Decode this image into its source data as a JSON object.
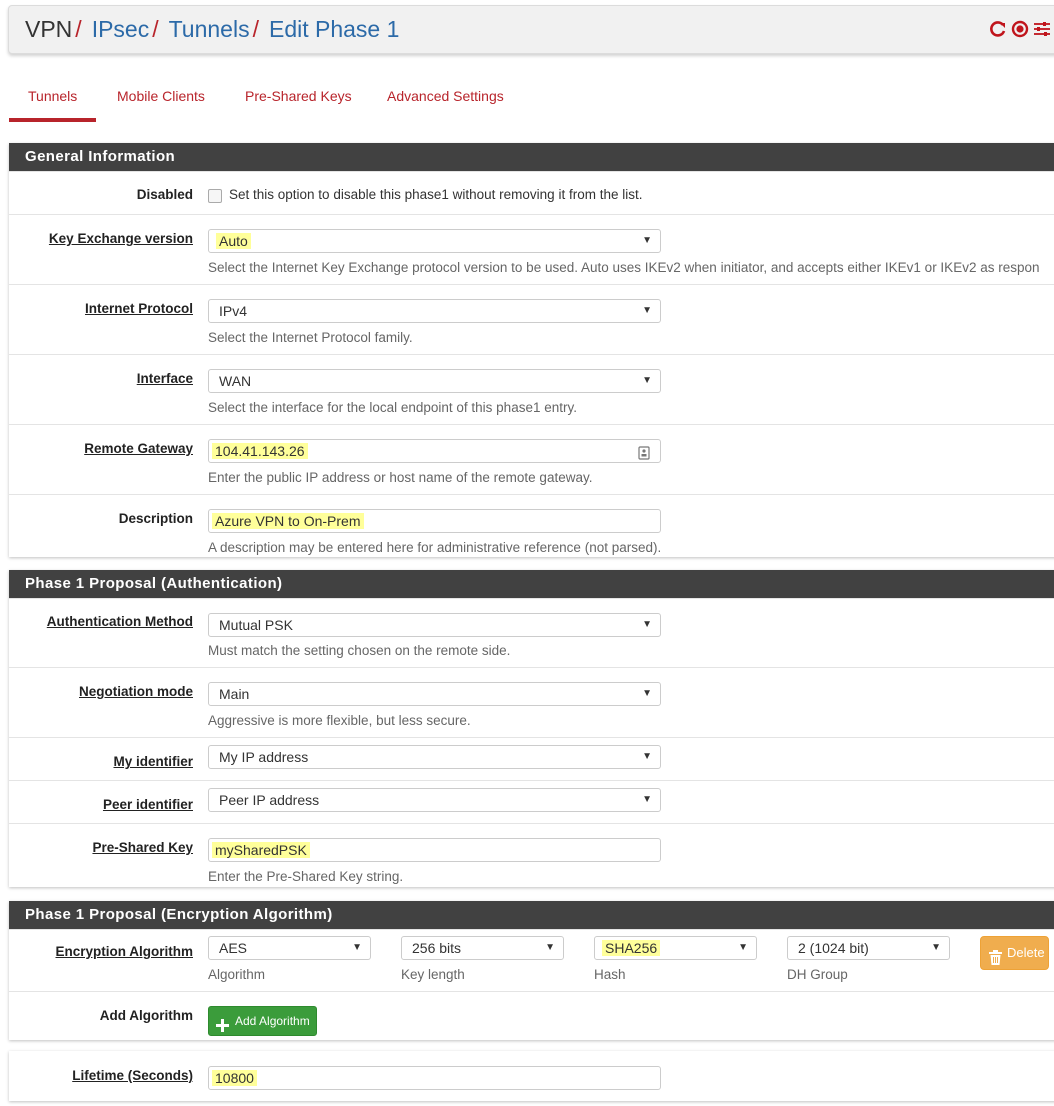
{
  "breadcrumb": {
    "items": [
      "VPN",
      "IPsec",
      "Tunnels",
      "Edit Phase 1"
    ],
    "separator": "/"
  },
  "header_icons": [
    "reload-icon",
    "stop-icon",
    "settings-sliders-icon"
  ],
  "tabs": [
    {
      "label": "Tunnels",
      "active": true
    },
    {
      "label": "Mobile Clients",
      "active": false
    },
    {
      "label": "Pre-Shared Keys",
      "active": false
    },
    {
      "label": "Advanced Settings",
      "active": false
    }
  ],
  "general": {
    "title": "General Information",
    "disabled": {
      "label": "Disabled",
      "checkbox_text": "Set this option to disable this phase1 without removing it from the list."
    },
    "key_exchange": {
      "label": "Key Exchange version",
      "value": "Auto",
      "help": "Select the Internet Key Exchange protocol version to be used. Auto uses IKEv2 when initiator, and accepts either IKEv1 or IKEv2 as respon"
    },
    "internet_protocol": {
      "label": "Internet Protocol",
      "value": "IPv4",
      "help": "Select the Internet Protocol family."
    },
    "interface": {
      "label": "Interface",
      "value": "WAN",
      "help": "Select the interface for the local endpoint of this phase1 entry."
    },
    "remote_gateway": {
      "label": "Remote Gateway",
      "value": "104.41.143.26",
      "help": "Enter the public IP address or host name of the remote gateway."
    },
    "description": {
      "label": "Description",
      "value": "Azure VPN to On-Prem",
      "help": "A description may be entered here for administrative reference (not parsed)."
    }
  },
  "auth": {
    "title": "Phase 1 Proposal (Authentication)",
    "method": {
      "label": "Authentication Method",
      "value": "Mutual PSK",
      "help": "Must match the setting chosen on the remote side."
    },
    "negotiation": {
      "label": "Negotiation mode",
      "value": "Main",
      "help": "Aggressive is more flexible, but less secure."
    },
    "my_identifier": {
      "label": "My identifier",
      "value": "My IP address"
    },
    "peer_identifier": {
      "label": "Peer identifier",
      "value": "Peer IP address"
    },
    "psk": {
      "label": "Pre-Shared Key",
      "value": "mySharedPSK",
      "help": "Enter the Pre-Shared Key string."
    }
  },
  "encryption": {
    "title": "Phase 1 Proposal (Encryption Algorithm)",
    "label": "Encryption Algorithm",
    "algorithm": {
      "value": "AES",
      "help": "Algorithm"
    },
    "key_length": {
      "value": "256 bits",
      "help": "Key length"
    },
    "hash": {
      "value": "SHA256",
      "help": "Hash"
    },
    "dh_group": {
      "value": "2 (1024 bit)",
      "help": "DH Group"
    },
    "delete_label": "Delete",
    "add_label": "Add Algorithm",
    "add_button": "Add Algorithm"
  },
  "lifetime": {
    "label": "Lifetime (Seconds)",
    "value": "10800"
  },
  "colors": {
    "accent_red": "#b8242b",
    "link_blue": "#2c6aa8",
    "panel_header": "#414141",
    "highlight": "#ffff9a",
    "add_green": "#3b9c3b",
    "delete_orange": "#f0ad4e"
  }
}
